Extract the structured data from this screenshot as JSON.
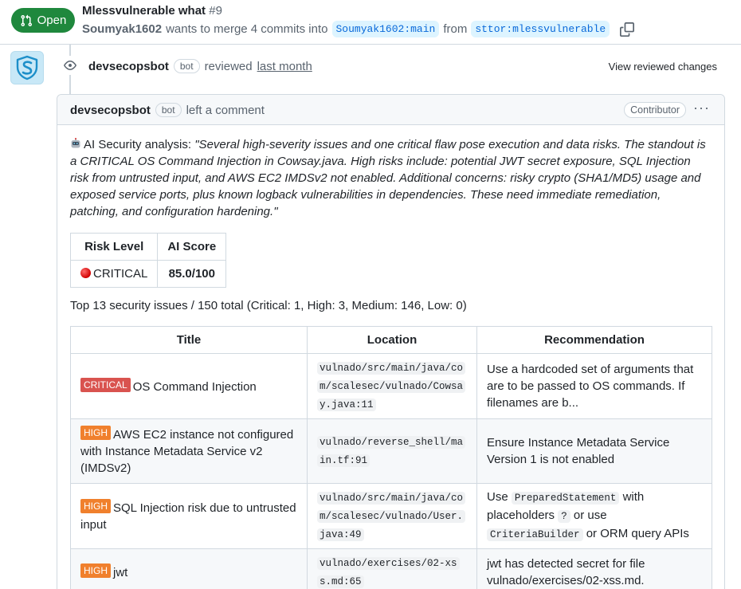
{
  "pr": {
    "state": "Open",
    "title": "Mlessvulnerable what",
    "number": "#9",
    "author": "Soumyak1602",
    "merge_text": "wants to merge 4 commits into",
    "base_branch": "Soumyak1602:main",
    "from_text": "from",
    "head_branch": "sttor:mlessvulnerable"
  },
  "review": {
    "reviewer": "devsecopsbot",
    "bot_label": "bot",
    "action": "reviewed",
    "when": "last month",
    "view_changes": "View reviewed changes"
  },
  "comment": {
    "author": "devsecopsbot",
    "bot_label": "bot",
    "action": "left a comment",
    "role": "Contributor",
    "menu": "···",
    "analysis_label": "AI Security analysis:",
    "analysis_quote": "\"Several high-severity issues and one critical flaw pose execution and data risks. The standout is a CRITICAL OS Command Injection in Cowsay.java. High risks include: potential JWT secret exposure, SQL Injection risk from untrusted input, and AWS EC2 IMDSv2 not enabled. Additional concerns: risky crypto (SHA1/MD5) usage and exposed service ports, plus known logback vulnerabilities in dependencies. These need immediate remediation, patching, and configuration hardening.\"",
    "risk_table": {
      "headers": [
        "Risk Level",
        "AI Score"
      ],
      "risk_level": "CRITICAL",
      "ai_score": "85.0/100"
    },
    "summary": "Top 13 security issues / 150 total (Critical: 1, High: 3, Medium: 146, Low: 0)",
    "issues_table": {
      "headers": [
        "Title",
        "Location",
        "Recommendation"
      ],
      "rows": [
        {
          "severity": "CRITICAL",
          "title": "OS Command Injection",
          "location": "vulnado/src/main/java/com/scalesec/vulnado/Cowsay.java:11",
          "recommendation": "Use a hardcoded set of arguments that are to be passed to OS commands. If filenames are b..."
        },
        {
          "severity": "HIGH",
          "title": "AWS EC2 instance not configured with Instance Metadata Service v2 (IMDSv2)",
          "location": "vulnado/reverse_shell/main.tf:91",
          "recommendation": "Ensure Instance Metadata Service Version 1 is not enabled"
        },
        {
          "severity": "HIGH",
          "title": "SQL Injection risk due to untrusted input",
          "location": "vulnado/src/main/java/com/scalesec/vulnado/User.java:49",
          "recommendation_parts": [
            "Use",
            "PreparedStatement",
            "with placeholders",
            "?",
            "or use",
            "CriteriaBuilder",
            "or ORM query APIs"
          ]
        },
        {
          "severity": "HIGH",
          "title": "jwt",
          "location": "vulnado/exercises/02-xss.md:65",
          "recommendation": "jwt has detected secret for file vulnado/exercises/02-xss.md."
        }
      ]
    }
  },
  "colors": {
    "open_green": "#1f883d",
    "link_blue": "#0969da",
    "critical_red": "#d9534f",
    "high_orange": "#f0802d"
  }
}
